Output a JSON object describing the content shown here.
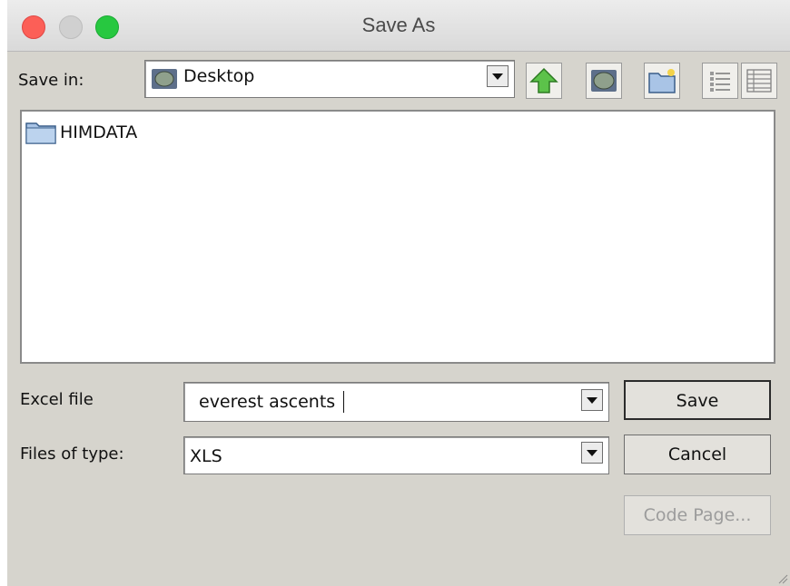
{
  "window": {
    "title": "Save As"
  },
  "save_in": {
    "label": "Save in:",
    "value": "Desktop",
    "icon": "desktop-icon"
  },
  "toolbar": {
    "up_icon": "up-one-level-icon",
    "desktop_icon": "desktop-icon",
    "new_folder_icon": "new-folder-icon",
    "list_icon": "list-view-icon",
    "details_icon": "details-view-icon"
  },
  "files": [
    {
      "name": "HIMDATA",
      "icon": "folder-icon"
    }
  ],
  "filename": {
    "label": "Excel file",
    "value": "everest ascents"
  },
  "filetype": {
    "label": "Files of type:",
    "value": "XLS"
  },
  "buttons": {
    "save": "Save",
    "cancel": "Cancel",
    "code_page": "Code Page..."
  },
  "colors": {
    "dialog_bg": "#d6d4cd",
    "close": "#fc5f57",
    "zoom": "#27c840"
  }
}
